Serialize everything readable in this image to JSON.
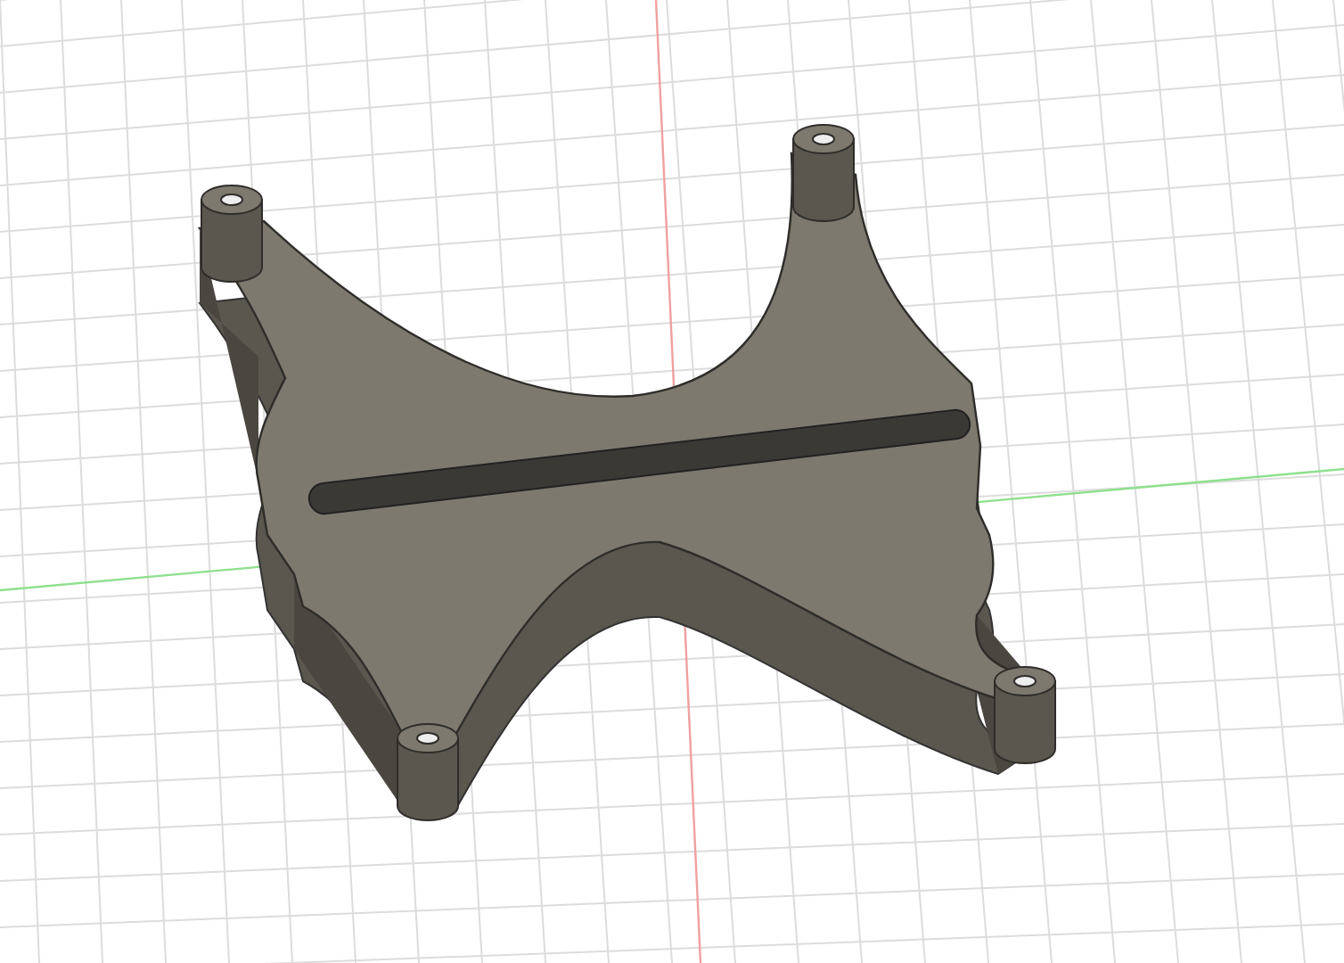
{
  "viewport": {
    "grid": true,
    "axes": true
  }
}
